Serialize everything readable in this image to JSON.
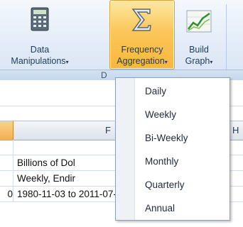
{
  "ribbon": {
    "buttons": [
      {
        "line1": "Data",
        "line2": "Manipulations",
        "icon": "calculator-icon"
      },
      {
        "line1": "Frequency",
        "line2": "Aggregation",
        "icon": "sigma-icon"
      },
      {
        "line1": "Build",
        "line2": "Graph",
        "icon": "line-graph-icon"
      }
    ],
    "dropdown_arrow": "▾",
    "group_label": "D"
  },
  "sheet": {
    "column_headers": [
      "F",
      "H"
    ],
    "rows": [
      {
        "e": "",
        "f": ""
      },
      {
        "e": "",
        "f": "Billions of Dol"
      },
      {
        "e": "",
        "f": "Weekly, Endir"
      },
      {
        "e": "0",
        "f": "1980-11-03 to 2011-07-10"
      }
    ]
  },
  "frequency_menu": {
    "items": [
      "Daily",
      "Weekly",
      "Bi-Weekly",
      "Monthly",
      "Quarterly",
      "Annual"
    ]
  },
  "colors": {
    "ribbon_bg": "#dfe9f5",
    "active_button": "#f9c04a",
    "selected_column_header": "#f3b052",
    "menu_border": "#8aa1bd"
  }
}
